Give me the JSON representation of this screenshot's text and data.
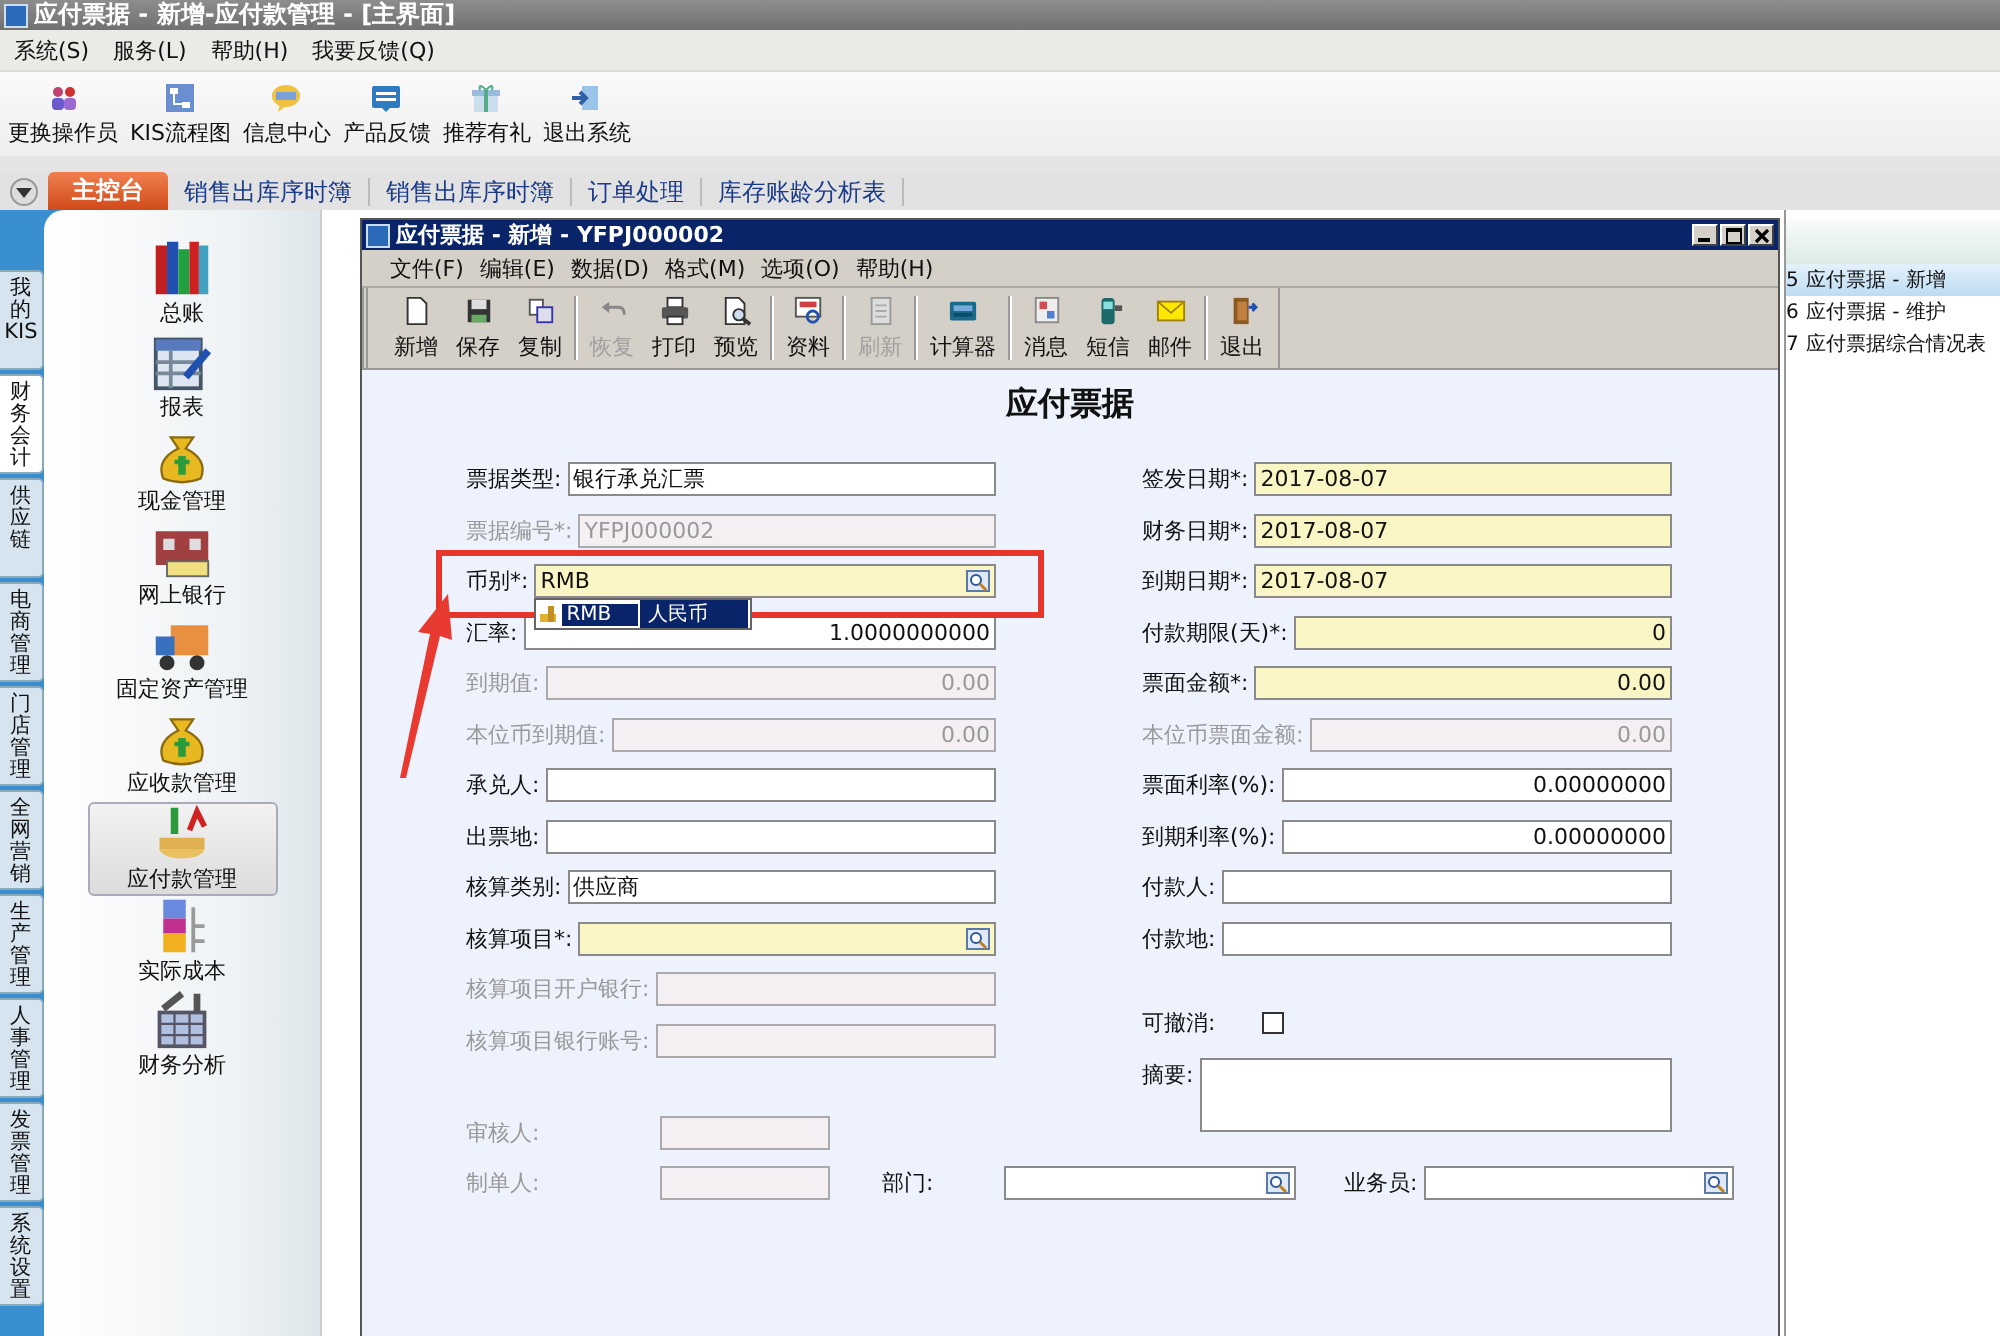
{
  "window": {
    "title": "应付票据 - 新增-应付款管理 - [主界面]"
  },
  "menu": [
    "系统(S)",
    "服务(L)",
    "帮助(H)",
    "我要反馈(Q)"
  ],
  "toolbar": [
    "更换操作员",
    "KIS流程图",
    "信息中心",
    "产品反馈",
    "推荐有礼",
    "退出系统"
  ],
  "tabs": [
    {
      "label": "主控台",
      "selected": true
    },
    {
      "label": "销售出库序时簿",
      "selected": false
    },
    {
      "label": "销售出库序时簿",
      "selected": false
    },
    {
      "label": "订单处理",
      "selected": false
    },
    {
      "label": "库存账龄分析表",
      "selected": false
    }
  ],
  "side_tabs": [
    {
      "label": "我的KIS",
      "selected": false
    },
    {
      "label": "财务会计",
      "selected": true
    },
    {
      "label": "供应链",
      "selected": false
    },
    {
      "label": "电商管理",
      "selected": false
    },
    {
      "label": "门店管理",
      "selected": false
    },
    {
      "label": "全网营销",
      "selected": false
    },
    {
      "label": "生产管理",
      "selected": false
    },
    {
      "label": "人事管理",
      "selected": false
    },
    {
      "label": "发票管理",
      "selected": false
    },
    {
      "label": "系统设置",
      "selected": false
    }
  ],
  "modules": [
    {
      "label": "总账",
      "selected": false
    },
    {
      "label": "报表",
      "selected": false
    },
    {
      "label": "现金管理",
      "selected": false
    },
    {
      "label": "网上银行",
      "selected": false
    },
    {
      "label": "固定资产管理",
      "selected": false
    },
    {
      "label": "应收款管理",
      "selected": false
    },
    {
      "label": "应付款管理",
      "selected": true
    },
    {
      "label": "实际成本",
      "selected": false
    },
    {
      "label": "财务分析",
      "selected": false
    }
  ],
  "task_list": [
    {
      "number": "5",
      "label": "应付票据 - 新增",
      "selected": true
    },
    {
      "number": "6",
      "label": "应付票据 - 维护",
      "selected": false
    },
    {
      "number": "7",
      "label": "应付票据综合情况表",
      "selected": false
    }
  ],
  "dialog": {
    "title": "应付票据 - 新增 - YFPJ000002",
    "menu": [
      "文件(F)",
      "编辑(E)",
      "数据(D)",
      "格式(M)",
      "选项(O)",
      "帮助(H)"
    ],
    "toolbar_groups": [
      [
        {
          "label": "新增",
          "disabled": false
        },
        {
          "label": "保存",
          "disabled": false
        },
        {
          "label": "复制",
          "disabled": false
        }
      ],
      [
        {
          "label": "恢复",
          "disabled": true
        },
        {
          "label": "打印",
          "disabled": false
        },
        {
          "label": "预览",
          "disabled": false
        }
      ],
      [
        {
          "label": "资料",
          "disabled": false
        }
      ],
      [
        {
          "label": "刷新",
          "disabled": true
        }
      ],
      [
        {
          "label": "计算器",
          "disabled": false
        }
      ],
      [
        {
          "label": "消息",
          "disabled": false
        },
        {
          "label": "短信",
          "disabled": false
        },
        {
          "label": "邮件",
          "disabled": false
        }
      ],
      [
        {
          "label": "退出",
          "disabled": false
        }
      ]
    ],
    "heading": "应付票据",
    "left_fields": [
      {
        "label": "票据类型:",
        "value": "银行承兑汇票",
        "kind": "text",
        "disabled": false,
        "required": false,
        "lookup": false
      },
      {
        "label": "票据编号*:",
        "value": "YFPJ000002",
        "kind": "text",
        "disabled": true,
        "required": false,
        "lookup": false
      },
      {
        "label": "币别*:",
        "value": "RMB",
        "kind": "text",
        "disabled": false,
        "required": true,
        "lookup": true,
        "suggestions": [
          {
            "code": "RMB",
            "name": "人民币",
            "selected": true
          }
        ]
      },
      {
        "label": "汇率:",
        "value": "1.0000000000",
        "kind": "number",
        "disabled": false,
        "required": false,
        "lookup": false
      },
      {
        "label": "到期值:",
        "value": "0.00",
        "kind": "number",
        "disabled": true,
        "required": false,
        "lookup": false
      },
      {
        "label": "本位币到期值:",
        "value": "0.00",
        "kind": "number",
        "disabled": true,
        "required": false,
        "lookup": false
      },
      {
        "label": "承兑人:",
        "kind": "text",
        "disabled": false,
        "required": false,
        "lookup": false
      },
      {
        "label": "出票地:",
        "kind": "text",
        "disabled": false,
        "required": false,
        "lookup": false
      },
      {
        "label": "核算类别:",
        "value": "供应商",
        "kind": "text",
        "disabled": false,
        "required": false,
        "lookup": false
      },
      {
        "label": "核算项目*:",
        "kind": "text",
        "disabled": false,
        "required": true,
        "lookup": true
      },
      {
        "label": "核算项目开户银行:",
        "kind": "text",
        "disabled": true,
        "required": false,
        "lookup": false
      },
      {
        "label": "核算项目银行账号:",
        "kind": "text",
        "disabled": true,
        "required": false,
        "lookup": false
      }
    ],
    "right_fields": [
      {
        "label": "签发日期*:",
        "value": "2017-08-07",
        "kind": "text",
        "disabled": false,
        "required": true,
        "lookup": false
      },
      {
        "label": "财务日期*:",
        "value": "2017-08-07",
        "kind": "text",
        "disabled": false,
        "required": true,
        "lookup": false
      },
      {
        "label": "到期日期*:",
        "value": "2017-08-07",
        "kind": "text",
        "disabled": false,
        "required": true,
        "lookup": false
      },
      {
        "label": "付款期限(天)*:",
        "value": "0",
        "kind": "number",
        "disabled": false,
        "required": true,
        "lookup": false
      },
      {
        "label": "票面金额*:",
        "value": "0.00",
        "kind": "number",
        "disabled": false,
        "required": true,
        "lookup": false
      },
      {
        "label": "本位币票面金额:",
        "value": "0.00",
        "kind": "number",
        "disabled": true,
        "required": false,
        "lookup": false
      },
      {
        "label": "票面利率(%):",
        "value": "0.00000000",
        "kind": "number",
        "disabled": false,
        "required": false,
        "lookup": false
      },
      {
        "label": "到期利率(%):",
        "value": "0.00000000",
        "kind": "number",
        "disabled": false,
        "required": false,
        "lookup": false
      },
      {
        "label": "付款人:",
        "kind": "text",
        "disabled": false,
        "required": false,
        "lookup": false
      },
      {
        "label": "付款地:",
        "kind": "text",
        "disabled": false,
        "required": false,
        "lookup": false
      },
      {
        "label": "可撤消:",
        "kind": "checkbox",
        "checked": false,
        "disabled": false
      },
      {
        "label": "摘要:",
        "kind": "memo",
        "disabled": false,
        "required": false,
        "lookup": false
      }
    ],
    "signature_rows": [
      [
        {
          "label": "审核人:",
          "disabled": true,
          "required": false,
          "lookup": false
        }
      ],
      [
        {
          "label": "制单人:",
          "disabled": true,
          "required": false,
          "lookup": false
        },
        {
          "label": "部门:",
          "disabled": false,
          "required": false,
          "lookup": true
        },
        {
          "label": "业务员:",
          "disabled": false,
          "required": false,
          "lookup": true
        }
      ]
    ]
  }
}
